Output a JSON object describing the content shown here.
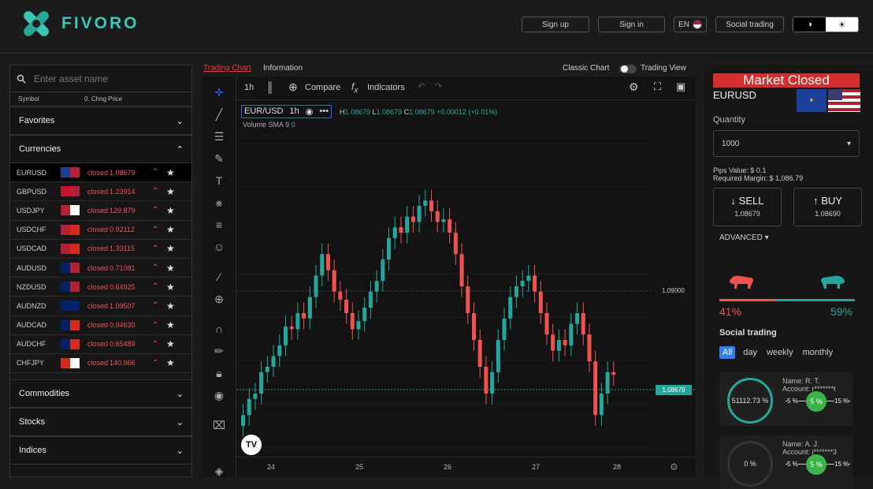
{
  "brand": {
    "name": "FIVORO",
    "accent": "#3cc8b4"
  },
  "header": {
    "signup": "Sign up",
    "signin": "Sign in",
    "lang": "EN",
    "social": "Social trading",
    "dark_icon": "◑",
    "light_icon": "☀"
  },
  "asset_list": {
    "search_placeholder": "Enter asset name",
    "columns": {
      "symbol": "Symbol",
      "change": "0. Chng",
      "price": "Price"
    },
    "sections": {
      "favorites": "Favorites",
      "currencies": "Currencies",
      "commodities": "Commodities",
      "stocks": "Stocks",
      "indices": "Indices"
    },
    "rows": [
      {
        "symbol": "EURUSD",
        "status": "closed",
        "price": "1.08679",
        "flag": [
          "#1c3f99",
          "#b22234"
        ]
      },
      {
        "symbol": "GBPUSD",
        "status": "closed",
        "price": "1.23914",
        "flag": [
          "#c8102e",
          "#b22234"
        ]
      },
      {
        "symbol": "USDJPY",
        "status": "closed",
        "price": "129.879",
        "flag": [
          "#b22234",
          "#ffffff"
        ]
      },
      {
        "symbol": "USDCHF",
        "status": "closed",
        "price": "0.92112",
        "flag": [
          "#b22234",
          "#d52b1e"
        ]
      },
      {
        "symbol": "USDCAD",
        "status": "closed",
        "price": "1.33115",
        "flag": [
          "#b22234",
          "#d52b1e"
        ]
      },
      {
        "symbol": "AUDUSD",
        "status": "closed",
        "price": "0.71081",
        "flag": [
          "#012169",
          "#b22234"
        ]
      },
      {
        "symbol": "NZDUSD",
        "status": "closed",
        "price": "0.64925",
        "flag": [
          "#012169",
          "#b22234"
        ]
      },
      {
        "symbol": "AUDNZD",
        "status": "closed",
        "price": "1.09507",
        "flag": [
          "#012169",
          "#012169"
        ]
      },
      {
        "symbol": "AUDCAD",
        "status": "closed",
        "price": "0.94630",
        "flag": [
          "#012169",
          "#d52b1e"
        ]
      },
      {
        "symbol": "AUDCHF",
        "status": "closed",
        "price": "0.65489",
        "flag": [
          "#012169",
          "#d52b1e"
        ]
      },
      {
        "symbol": "CHFJPY",
        "status": "closed",
        "price": "140.966",
        "flag": [
          "#d52b1e",
          "#ffffff"
        ]
      }
    ]
  },
  "chart": {
    "tab_active": "Trading Chart",
    "tab_info": "Information",
    "classic": "Classic Chart",
    "trading_view": "Trading View",
    "interval": "1h",
    "compare": "Compare",
    "indicators": "Indicators",
    "symbol": "EUR/USD",
    "sym_interval": "1h",
    "ohlc": {
      "h": "H",
      "h_val": "1.08679",
      "l": "L",
      "l_val": "1.08679",
      "c": "C",
      "c_val": "1.08679",
      "chg": "+0.00012 (+0.01%)"
    },
    "volume": "Volume",
    "sma": "SMA 9",
    "vol_val": "0",
    "price_labels": {
      "p1": "1.09000",
      "p2": "1.08679"
    },
    "dates": [
      "24",
      "25",
      "26",
      "27",
      "28"
    ],
    "tv_logo": "TV"
  },
  "chart_data": {
    "type": "candlestick",
    "x": [
      "24",
      "25",
      "26",
      "27",
      "28"
    ],
    "y_ticks": [
      "1.09000"
    ],
    "last_price": "1.08679",
    "candles_close_norm": [
      0.12,
      0.18,
      0.2,
      0.28,
      0.3,
      0.34,
      0.38,
      0.45,
      0.44,
      0.5,
      0.48,
      0.56,
      0.64,
      0.72,
      0.66,
      0.58,
      0.55,
      0.5,
      0.44,
      0.47,
      0.52,
      0.58,
      0.62,
      0.7,
      0.78,
      0.82,
      0.8,
      0.86,
      0.84,
      0.9,
      0.92,
      0.88,
      0.84,
      0.85,
      0.8,
      0.72,
      0.6,
      0.5,
      0.4,
      0.3,
      0.2,
      0.28,
      0.4,
      0.48,
      0.56,
      0.6,
      0.62,
      0.64,
      0.58,
      0.5,
      0.42,
      0.36,
      0.4,
      0.38,
      0.46,
      0.5,
      0.42,
      0.32,
      0.12,
      0.2,
      0.28,
      0.27
    ]
  },
  "trade": {
    "banner": "Market Closed",
    "pair": "EURUSD",
    "qty_label": "Quantity",
    "qty_value": "1000",
    "pips": "Pips Value: $ 0.1",
    "margin": "Required Margin: $ 1,086.79",
    "sell": "SELL",
    "sell_price": "1.08679",
    "buy": "BUY",
    "buy_price": "1.08690",
    "advanced": "ADVANCED",
    "bear_pct": "41%",
    "bull_pct": "59%",
    "social_title": "Social trading",
    "filters": [
      "All",
      "day",
      "weekly",
      "monthly"
    ],
    "cards": [
      {
        "name": "Name: R. T.",
        "account": "Account: r*******t",
        "pct": "51112.73 %",
        "left": "5 %",
        "mid": "5 %",
        "right": "15 %"
      },
      {
        "name": "Name: A. J.",
        "account": "Account: j*******3",
        "pct": "0 %",
        "left": "5 %",
        "mid": "5 %",
        "right": "15 %"
      }
    ],
    "colors": {
      "up": "#26a69a",
      "down": "#ef5350",
      "banner": "#d32f2f"
    }
  }
}
